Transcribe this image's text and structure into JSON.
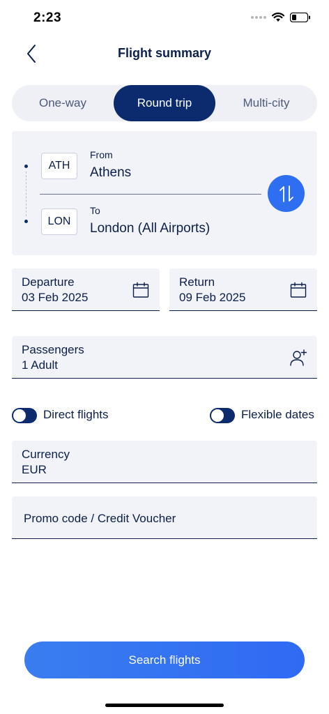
{
  "status_bar": {
    "time": "2:23",
    "icons": [
      "signal-dots-icon",
      "wifi-icon",
      "battery-icon"
    ]
  },
  "header": {
    "title": "Flight summary",
    "back_icon": "chevron-left-icon"
  },
  "trip_types": [
    {
      "label": "One-way",
      "selected": false
    },
    {
      "label": "Round trip",
      "selected": true
    },
    {
      "label": "Multi-city",
      "selected": false
    }
  ],
  "route": {
    "from": {
      "label": "From",
      "code": "ATH",
      "city": "Athens"
    },
    "to": {
      "label": "To",
      "code": "LON",
      "city": "London (All Airports)"
    },
    "swap_icon": "swap-arrows-icon"
  },
  "dates": {
    "departure": {
      "label": "Departure",
      "value": "03 Feb 2025",
      "icon": "calendar-icon"
    },
    "return": {
      "label": "Return",
      "value": "09 Feb 2025",
      "icon": "calendar-icon"
    }
  },
  "passengers": {
    "label": "Passengers",
    "value": "1 Adult",
    "icon": "add-person-icon"
  },
  "toggles": {
    "direct_flights": {
      "label": "Direct flights",
      "on": false
    },
    "flexible_dates": {
      "label": "Flexible dates",
      "on": false
    }
  },
  "currency": {
    "label": "Currency",
    "value": "EUR"
  },
  "promo": {
    "placeholder": "Promo code / Credit Voucher"
  },
  "search_button": {
    "label": "Search flights"
  },
  "colors": {
    "navy": "#0c2b6e",
    "text": "#0c1f4a",
    "accent_blue": "#2e6ff2",
    "field_bg": "#f1f3f8"
  }
}
